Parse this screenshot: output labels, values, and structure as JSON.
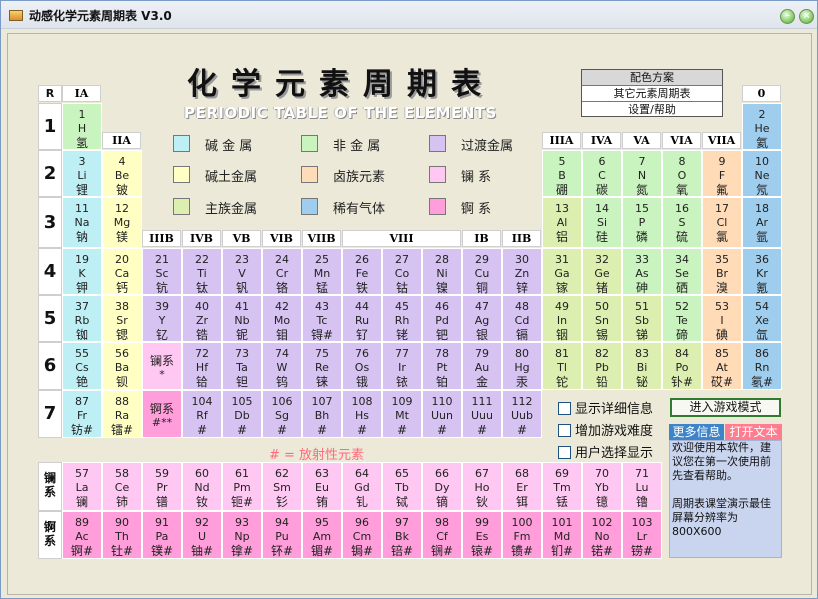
{
  "window": {
    "title": "动感化学元素周期表  V3.0"
  },
  "header": {
    "title": "化学元素周期表",
    "subtitle": "PERIODIC TABLE OF THE ELEMENTS"
  },
  "menu": [
    "配色方案",
    "其它元素周期表",
    "设置/帮助"
  ],
  "corner_label": "R",
  "period_labels": [
    "1",
    "2",
    "3",
    "4",
    "5",
    "6",
    "7"
  ],
  "group_headers": {
    "IA": "IA",
    "IIA": "IIA",
    "IIIB": "IIIB",
    "IVB": "IVB",
    "VB": "VB",
    "VIB": "VIB",
    "VIIB": "VIIB",
    "VIII": "VIII",
    "IB": "IB",
    "IIB": "IIB",
    "IIIA": "IIIA",
    "IVA": "IVA",
    "VA": "VA",
    "VIA": "VIA",
    "VIIA": "VIIA",
    "zero": "0"
  },
  "legend": [
    {
      "label": "碱 金 属",
      "color": "#BDEFF4"
    },
    {
      "label": "非 金 属",
      "color": "#C9F3BF"
    },
    {
      "label": "过渡金属",
      "color": "#D6C3F2"
    },
    {
      "label": "碱土金属",
      "color": "#FFFFC4"
    },
    {
      "label": "卤族元素",
      "color": "#FFDBB8"
    },
    {
      "label": "镧      系",
      "color": "#FFC8F2"
    },
    {
      "label": "主族金属",
      "color": "#DDEFB0"
    },
    {
      "label": "稀有气体",
      "color": "#9ECDEE"
    },
    {
      "label": "锕      系",
      "color": "#FF9EDA"
    }
  ],
  "radioactive_note": "# = 放射性元素",
  "series_labels": {
    "lanthanide": "镧\n系",
    "actinide": "锕\n系"
  },
  "checkboxes": [
    "显示详细信息",
    "增加游戏难度",
    "用户选择显示"
  ],
  "game_button": "进入游戏模式",
  "tabs": [
    "更多信息",
    "打开文本"
  ],
  "info_text": "  欢迎使用本软件，建议您在第一次使用前先查看帮助。\n\n   周期表课堂演示最佳屏幕分辨率为800X600",
  "elements": [
    {
      "n": "1",
      "s": "H",
      "z": "氢",
      "p": 1,
      "g": 1,
      "c": "nonmetal"
    },
    {
      "n": "2",
      "s": "He",
      "z": "氦",
      "p": 1,
      "g": 18,
      "c": "noble"
    },
    {
      "n": "3",
      "s": "Li",
      "z": "锂",
      "p": 2,
      "g": 1,
      "c": "alkali"
    },
    {
      "n": "4",
      "s": "Be",
      "z": "铍",
      "p": 2,
      "g": 2,
      "c": "alkaline"
    },
    {
      "n": "5",
      "s": "B",
      "z": "硼",
      "p": 2,
      "g": 13,
      "c": "nonmetal"
    },
    {
      "n": "6",
      "s": "C",
      "z": "碳",
      "p": 2,
      "g": 14,
      "c": "nonmetal"
    },
    {
      "n": "7",
      "s": "N",
      "z": "氮",
      "p": 2,
      "g": 15,
      "c": "nonmetal"
    },
    {
      "n": "8",
      "s": "O",
      "z": "氧",
      "p": 2,
      "g": 16,
      "c": "nonmetal"
    },
    {
      "n": "9",
      "s": "F",
      "z": "氟",
      "p": 2,
      "g": 17,
      "c": "halogen"
    },
    {
      "n": "10",
      "s": "Ne",
      "z": "氖",
      "p": 2,
      "g": 18,
      "c": "noble"
    },
    {
      "n": "11",
      "s": "Na",
      "z": "钠",
      "p": 3,
      "g": 1,
      "c": "alkali"
    },
    {
      "n": "12",
      "s": "Mg",
      "z": "镁",
      "p": 3,
      "g": 2,
      "c": "alkaline"
    },
    {
      "n": "13",
      "s": "Al",
      "z": "铝",
      "p": 3,
      "g": 13,
      "c": "main"
    },
    {
      "n": "14",
      "s": "Si",
      "z": "硅",
      "p": 3,
      "g": 14,
      "c": "nonmetal"
    },
    {
      "n": "15",
      "s": "P",
      "z": "磷",
      "p": 3,
      "g": 15,
      "c": "nonmetal"
    },
    {
      "n": "16",
      "s": "S",
      "z": "硫",
      "p": 3,
      "g": 16,
      "c": "nonmetal"
    },
    {
      "n": "17",
      "s": "Cl",
      "z": "氯",
      "p": 3,
      "g": 17,
      "c": "halogen"
    },
    {
      "n": "18",
      "s": "Ar",
      "z": "氩",
      "p": 3,
      "g": 18,
      "c": "noble"
    },
    {
      "n": "19",
      "s": "K",
      "z": "钾",
      "p": 4,
      "g": 1,
      "c": "alkali"
    },
    {
      "n": "20",
      "s": "Ca",
      "z": "钙",
      "p": 4,
      "g": 2,
      "c": "alkaline"
    },
    {
      "n": "21",
      "s": "Sc",
      "z": "钪",
      "p": 4,
      "g": 3,
      "c": "trans"
    },
    {
      "n": "22",
      "s": "Ti",
      "z": "钛",
      "p": 4,
      "g": 4,
      "c": "trans"
    },
    {
      "n": "23",
      "s": "V",
      "z": "钒",
      "p": 4,
      "g": 5,
      "c": "trans"
    },
    {
      "n": "24",
      "s": "Cr",
      "z": "铬",
      "p": 4,
      "g": 6,
      "c": "trans"
    },
    {
      "n": "25",
      "s": "Mn",
      "z": "锰",
      "p": 4,
      "g": 7,
      "c": "trans"
    },
    {
      "n": "26",
      "s": "Fe",
      "z": "铁",
      "p": 4,
      "g": 8,
      "c": "trans"
    },
    {
      "n": "27",
      "s": "Co",
      "z": "钴",
      "p": 4,
      "g": 9,
      "c": "trans"
    },
    {
      "n": "28",
      "s": "Ni",
      "z": "镍",
      "p": 4,
      "g": 10,
      "c": "trans"
    },
    {
      "n": "29",
      "s": "Cu",
      "z": "铜",
      "p": 4,
      "g": 11,
      "c": "trans"
    },
    {
      "n": "30",
      "s": "Zn",
      "z": "锌",
      "p": 4,
      "g": 12,
      "c": "trans"
    },
    {
      "n": "31",
      "s": "Ga",
      "z": "镓",
      "p": 4,
      "g": 13,
      "c": "main"
    },
    {
      "n": "32",
      "s": "Ge",
      "z": "锗",
      "p": 4,
      "g": 14,
      "c": "main"
    },
    {
      "n": "33",
      "s": "As",
      "z": "砷",
      "p": 4,
      "g": 15,
      "c": "nonmetal"
    },
    {
      "n": "34",
      "s": "Se",
      "z": "硒",
      "p": 4,
      "g": 16,
      "c": "nonmetal"
    },
    {
      "n": "35",
      "s": "Br",
      "z": "溴",
      "p": 4,
      "g": 17,
      "c": "halogen"
    },
    {
      "n": "36",
      "s": "Kr",
      "z": "氪",
      "p": 4,
      "g": 18,
      "c": "noble"
    },
    {
      "n": "37",
      "s": "Rb",
      "z": "铷",
      "p": 5,
      "g": 1,
      "c": "alkali"
    },
    {
      "n": "38",
      "s": "Sr",
      "z": "锶",
      "p": 5,
      "g": 2,
      "c": "alkaline"
    },
    {
      "n": "39",
      "s": "Y",
      "z": "钇",
      "p": 5,
      "g": 3,
      "c": "trans"
    },
    {
      "n": "40",
      "s": "Zr",
      "z": "锆",
      "p": 5,
      "g": 4,
      "c": "trans"
    },
    {
      "n": "41",
      "s": "Nb",
      "z": "铌",
      "p": 5,
      "g": 5,
      "c": "trans"
    },
    {
      "n": "42",
      "s": "Mo",
      "z": "钼",
      "p": 5,
      "g": 6,
      "c": "trans"
    },
    {
      "n": "43",
      "s": "Tc",
      "z": "锝#",
      "p": 5,
      "g": 7,
      "c": "trans"
    },
    {
      "n": "44",
      "s": "Ru",
      "z": "钌",
      "p": 5,
      "g": 8,
      "c": "trans"
    },
    {
      "n": "45",
      "s": "Rh",
      "z": "铑",
      "p": 5,
      "g": 9,
      "c": "trans"
    },
    {
      "n": "46",
      "s": "Pd",
      "z": "钯",
      "p": 5,
      "g": 10,
      "c": "trans"
    },
    {
      "n": "47",
      "s": "Ag",
      "z": "银",
      "p": 5,
      "g": 11,
      "c": "trans"
    },
    {
      "n": "48",
      "s": "Cd",
      "z": "镉",
      "p": 5,
      "g": 12,
      "c": "trans"
    },
    {
      "n": "49",
      "s": "In",
      "z": "铟",
      "p": 5,
      "g": 13,
      "c": "main"
    },
    {
      "n": "50",
      "s": "Sn",
      "z": "锡",
      "p": 5,
      "g": 14,
      "c": "main"
    },
    {
      "n": "51",
      "s": "Sb",
      "z": "锑",
      "p": 5,
      "g": 15,
      "c": "main"
    },
    {
      "n": "52",
      "s": "Te",
      "z": "碲",
      "p": 5,
      "g": 16,
      "c": "nonmetal"
    },
    {
      "n": "53",
      "s": "I",
      "z": "碘",
      "p": 5,
      "g": 17,
      "c": "halogen"
    },
    {
      "n": "54",
      "s": "Xe",
      "z": "氙",
      "p": 5,
      "g": 18,
      "c": "noble"
    },
    {
      "n": "55",
      "s": "Cs",
      "z": "铯",
      "p": 6,
      "g": 1,
      "c": "alkali"
    },
    {
      "n": "56",
      "s": "Ba",
      "z": "钡",
      "p": 6,
      "g": 2,
      "c": "alkaline"
    },
    {
      "n": "",
      "s": "镧系",
      "z": "*",
      "p": 6,
      "g": 3,
      "c": "lan",
      "special": true
    },
    {
      "n": "72",
      "s": "Hf",
      "z": "铪",
      "p": 6,
      "g": 4,
      "c": "trans"
    },
    {
      "n": "73",
      "s": "Ta",
      "z": "钽",
      "p": 6,
      "g": 5,
      "c": "trans"
    },
    {
      "n": "74",
      "s": "W",
      "z": "钨",
      "p": 6,
      "g": 6,
      "c": "trans"
    },
    {
      "n": "75",
      "s": "Re",
      "z": "铼",
      "p": 6,
      "g": 7,
      "c": "trans"
    },
    {
      "n": "76",
      "s": "Os",
      "z": "锇",
      "p": 6,
      "g": 8,
      "c": "trans"
    },
    {
      "n": "77",
      "s": "Ir",
      "z": "铱",
      "p": 6,
      "g": 9,
      "c": "trans"
    },
    {
      "n": "78",
      "s": "Pt",
      "z": "铂",
      "p": 6,
      "g": 10,
      "c": "trans"
    },
    {
      "n": "79",
      "s": "Au",
      "z": "金",
      "p": 6,
      "g": 11,
      "c": "trans"
    },
    {
      "n": "80",
      "s": "Hg",
      "z": "汞",
      "p": 6,
      "g": 12,
      "c": "trans"
    },
    {
      "n": "81",
      "s": "Tl",
      "z": "铊",
      "p": 6,
      "g": 13,
      "c": "main"
    },
    {
      "n": "82",
      "s": "Pb",
      "z": "铅",
      "p": 6,
      "g": 14,
      "c": "main"
    },
    {
      "n": "83",
      "s": "Bi",
      "z": "铋",
      "p": 6,
      "g": 15,
      "c": "main"
    },
    {
      "n": "84",
      "s": "Po",
      "z": "钋#",
      "p": 6,
      "g": 16,
      "c": "main"
    },
    {
      "n": "85",
      "s": "At",
      "z": "砹#",
      "p": 6,
      "g": 17,
      "c": "halogen"
    },
    {
      "n": "86",
      "s": "Rn",
      "z": "氡#",
      "p": 6,
      "g": 18,
      "c": "noble"
    },
    {
      "n": "87",
      "s": "Fr",
      "z": "钫#",
      "p": 7,
      "g": 1,
      "c": "alkali"
    },
    {
      "n": "88",
      "s": "Ra",
      "z": "镭#",
      "p": 7,
      "g": 2,
      "c": "alkaline"
    },
    {
      "n": "",
      "s": "锕系",
      "z": "#**",
      "p": 7,
      "g": 3,
      "c": "act",
      "special": true
    },
    {
      "n": "104",
      "s": "Rf",
      "z": "#",
      "p": 7,
      "g": 4,
      "c": "trans"
    },
    {
      "n": "105",
      "s": "Db",
      "z": "#",
      "p": 7,
      "g": 5,
      "c": "trans"
    },
    {
      "n": "106",
      "s": "Sg",
      "z": "#",
      "p": 7,
      "g": 6,
      "c": "trans"
    },
    {
      "n": "107",
      "s": "Bh",
      "z": "#",
      "p": 7,
      "g": 7,
      "c": "trans"
    },
    {
      "n": "108",
      "s": "Hs",
      "z": "#",
      "p": 7,
      "g": 8,
      "c": "trans"
    },
    {
      "n": "109",
      "s": "Mt",
      "z": "#",
      "p": 7,
      "g": 9,
      "c": "trans"
    },
    {
      "n": "110",
      "s": "Uun",
      "z": "#",
      "p": 7,
      "g": 10,
      "c": "trans"
    },
    {
      "n": "111",
      "s": "Uuu",
      "z": "#",
      "p": 7,
      "g": 11,
      "c": "trans"
    },
    {
      "n": "112",
      "s": "Uub",
      "z": "#",
      "p": 7,
      "g": 12,
      "c": "trans"
    }
  ],
  "lanthanides": [
    {
      "n": "57",
      "s": "La",
      "z": "镧"
    },
    {
      "n": "58",
      "s": "Ce",
      "z": "铈"
    },
    {
      "n": "59",
      "s": "Pr",
      "z": "镨"
    },
    {
      "n": "60",
      "s": "Nd",
      "z": "钕"
    },
    {
      "n": "61",
      "s": "Pm",
      "z": "钷#"
    },
    {
      "n": "62",
      "s": "Sm",
      "z": "钐"
    },
    {
      "n": "63",
      "s": "Eu",
      "z": "铕"
    },
    {
      "n": "64",
      "s": "Gd",
      "z": "钆"
    },
    {
      "n": "65",
      "s": "Tb",
      "z": "铽"
    },
    {
      "n": "66",
      "s": "Dy",
      "z": "镝"
    },
    {
      "n": "67",
      "s": "Ho",
      "z": "钬"
    },
    {
      "n": "68",
      "s": "Er",
      "z": "铒"
    },
    {
      "n": "69",
      "s": "Tm",
      "z": "铥"
    },
    {
      "n": "70",
      "s": "Yb",
      "z": "镱"
    },
    {
      "n": "71",
      "s": "Lu",
      "z": "镥"
    }
  ],
  "actinides": [
    {
      "n": "89",
      "s": "Ac",
      "z": "锕#"
    },
    {
      "n": "90",
      "s": "Th",
      "z": "钍#"
    },
    {
      "n": "91",
      "s": "Pa",
      "z": "镤#"
    },
    {
      "n": "92",
      "s": "U",
      "z": "铀#"
    },
    {
      "n": "93",
      "s": "Np",
      "z": "镎#"
    },
    {
      "n": "94",
      "s": "Pu",
      "z": "钚#"
    },
    {
      "n": "95",
      "s": "Am",
      "z": "镅#"
    },
    {
      "n": "96",
      "s": "Cm",
      "z": "锔#"
    },
    {
      "n": "97",
      "s": "Bk",
      "z": "锫#"
    },
    {
      "n": "98",
      "s": "Cf",
      "z": "锎#"
    },
    {
      "n": "99",
      "s": "Es",
      "z": "锿#"
    },
    {
      "n": "100",
      "s": "Fm",
      "z": "镄#"
    },
    {
      "n": "101",
      "s": "Md",
      "z": "钔#"
    },
    {
      "n": "102",
      "s": "No",
      "z": "锘#"
    },
    {
      "n": "103",
      "s": "Lr",
      "z": "铹#"
    }
  ]
}
